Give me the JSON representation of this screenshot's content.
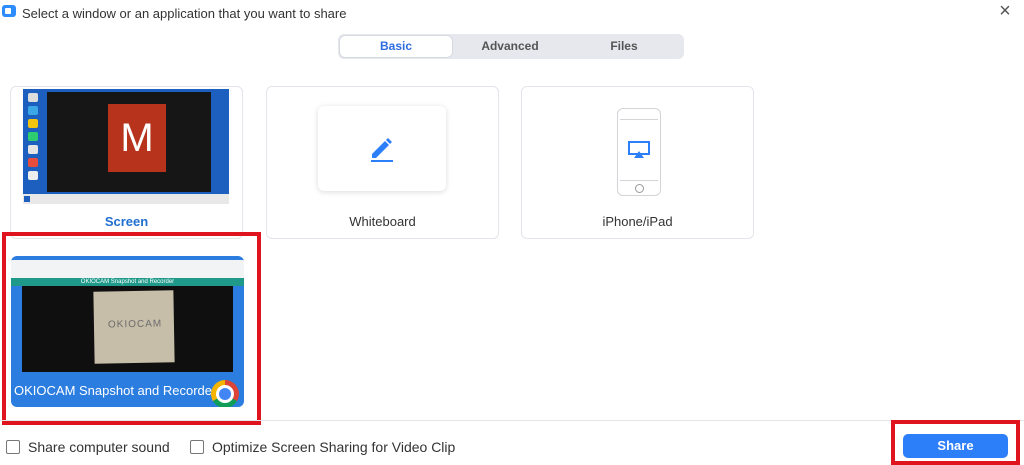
{
  "window": {
    "title": "Select a window or an application that you want to share"
  },
  "tabs": [
    {
      "label": "Basic",
      "active": true
    },
    {
      "label": "Advanced",
      "active": false
    },
    {
      "label": "Files",
      "active": false
    }
  ],
  "options": {
    "screen": {
      "label": "Screen",
      "tile_letter": "M"
    },
    "whiteboard": {
      "label": "Whiteboard",
      "icon": "pencil-icon"
    },
    "iphone_ipad": {
      "label": "iPhone/iPad",
      "icon": "airplay-icon"
    }
  },
  "windows": [
    {
      "label": "OKIOCAM Snapshot and Recorde...",
      "page_heading": "OKIOCAM Snapshot and Recorder",
      "paper_text": "OKIOCAM",
      "icon": "chrome-icon"
    }
  ],
  "footer": {
    "share_sound_label": "Share computer sound",
    "optimize_label": "Optimize Screen Sharing for Video Clip",
    "share_button": "Share"
  },
  "colors": {
    "accent": "#2d7ff9",
    "highlight": "#e0141e"
  }
}
